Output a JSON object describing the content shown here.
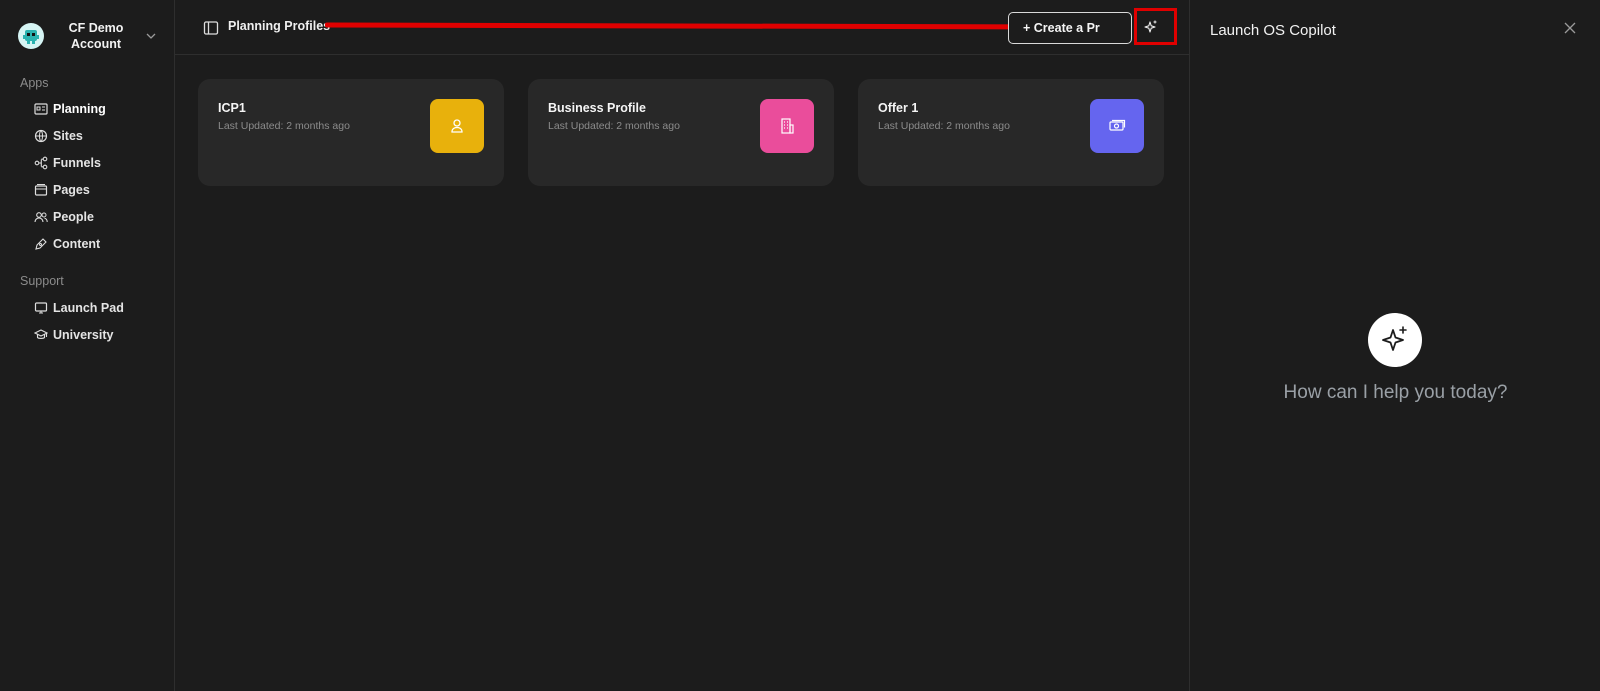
{
  "account": {
    "name": "CF Demo Account"
  },
  "sidebar": {
    "apps_label": "Apps",
    "apps": [
      {
        "label": "Planning",
        "icon": "planning-icon",
        "active": true
      },
      {
        "label": "Sites",
        "icon": "globe-icon"
      },
      {
        "label": "Funnels",
        "icon": "funnel-icon"
      },
      {
        "label": "Pages",
        "icon": "pages-icon"
      },
      {
        "label": "People",
        "icon": "people-icon"
      },
      {
        "label": "Content",
        "icon": "pen-icon"
      }
    ],
    "support_label": "Support",
    "support": [
      {
        "label": "Launch Pad",
        "icon": "launch-pad-icon"
      },
      {
        "label": "University",
        "icon": "graduation-cap-icon"
      }
    ]
  },
  "header": {
    "title": "Planning Profiles",
    "create_label": "+ Create a Pr"
  },
  "cards": [
    {
      "title": "ICP1",
      "subtitle": "Last Updated: 2 months ago",
      "icon": "person-icon",
      "color": "#e8b10c"
    },
    {
      "title": "Business Profile",
      "subtitle": "Last Updated: 2 months ago",
      "icon": "building-icon",
      "color": "#ea4d9b"
    },
    {
      "title": "Offer 1",
      "subtitle": "Last Updated: 2 months ago",
      "icon": "money-icon",
      "color": "#6565ef"
    }
  ],
  "copilot": {
    "title": "Launch OS Copilot",
    "prompt": "How can I help you today?"
  },
  "colors": {
    "annotation": "#e00000",
    "background": "#1c1c1c",
    "card": "#282828"
  }
}
